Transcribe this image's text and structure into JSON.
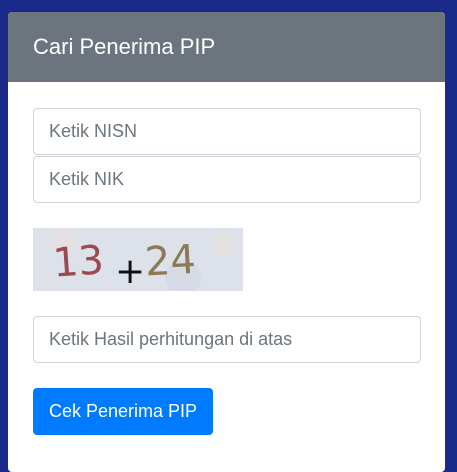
{
  "card": {
    "title": "Cari Penerima PIP"
  },
  "form": {
    "nisn_placeholder": "Ketik NISN",
    "nik_placeholder": "Ketik NIK",
    "hasil_placeholder": "Ketik Hasil perhitungan di atas",
    "submit_label": "Cek Penerima PIP"
  },
  "captcha": {
    "first": "13",
    "operator": "+",
    "second": "24"
  },
  "colors": {
    "background": "#1a2a8a",
    "header": "#6c757d",
    "button": "#007bff"
  }
}
